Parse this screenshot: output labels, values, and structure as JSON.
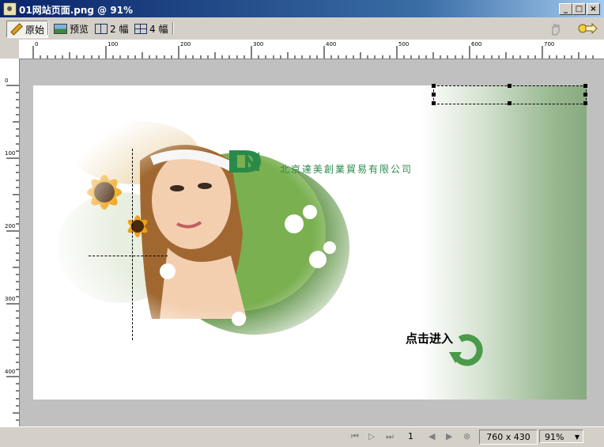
{
  "window": {
    "title": "01网站页面.png @ 91%",
    "min_label": "_",
    "max_label": "□",
    "close_label": "×"
  },
  "toolbar": {
    "original_label": "原始",
    "preview_label": "预览",
    "two_up_label": "2 幅",
    "four_up_label": "4 幅"
  },
  "ruler": {
    "h_labels": [
      "0",
      "100",
      "200",
      "300",
      "400",
      "500",
      "600",
      "700"
    ],
    "v_labels": [
      "0",
      "100",
      "200",
      "300",
      "400"
    ]
  },
  "canvas": {
    "company_name": "北京達美創業貿易有限公司",
    "enter_text": "点击进入",
    "logo_letters": "DM",
    "colors": {
      "brand_green": "#2a8a4a",
      "band_green": "#88aa80"
    }
  },
  "statusbar": {
    "page_number": "1",
    "dimensions": "760 x 430",
    "zoom": "91%"
  }
}
